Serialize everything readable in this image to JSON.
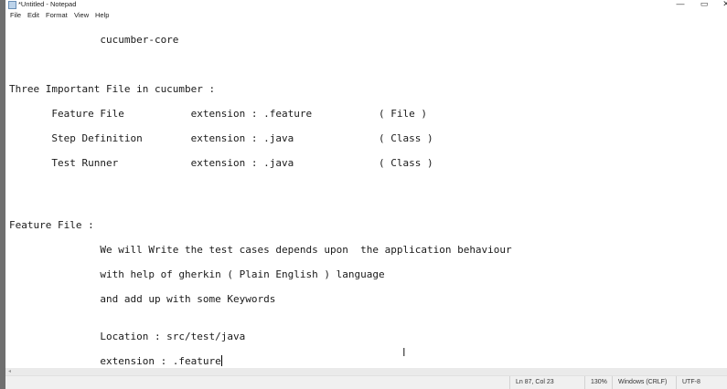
{
  "window": {
    "title": "*Untitled - Notepad",
    "minimize_glyph": "—",
    "maximize_glyph": "▭",
    "close_glyph": "✕"
  },
  "menu": {
    "file": "File",
    "edit": "Edit",
    "format": "Format",
    "view": "View",
    "help": "Help"
  },
  "editor": {
    "lines": [
      "               cucumber-core",
      "Three Important File in cucumber :",
      "       Feature File           extension : .feature           ( File )",
      "       Step Definition        extension : .java              ( Class )",
      "       Test Runner            extension : .java              ( Class )",
      "Feature File :",
      "               We will Write the test cases depends upon  the application behaviour",
      "               with help of gherkin ( Plain English ) language",
      "               and add up with some Keywords",
      "               Location : src/test/java",
      "               extension : .feature"
    ]
  },
  "status": {
    "position": "Ln 87, Col 23",
    "zoom": "130%",
    "line_ending": "Windows (CRLF)",
    "encoding": "UTF-8"
  }
}
